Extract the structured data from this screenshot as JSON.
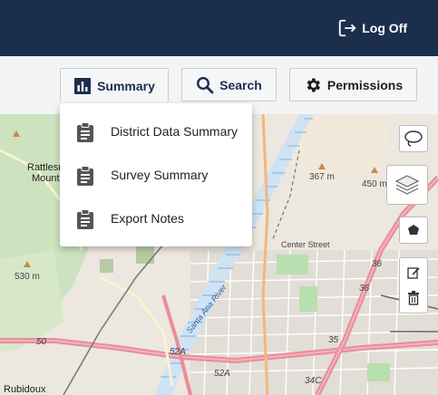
{
  "header": {
    "logoff_label": "Log Off",
    "background": "#1b2f4d"
  },
  "toolbar": {
    "summary_label": "Summary",
    "search_label": "Search",
    "permissions_label": "Permissions"
  },
  "summary_menu": {
    "items": [
      {
        "label": "District Data Summary",
        "icon": "clipboard-icon"
      },
      {
        "label": "Survey Summary",
        "icon": "clipboard-icon"
      },
      {
        "label": "Export Notes",
        "icon": "clipboard-icon"
      }
    ]
  },
  "map": {
    "labels": {
      "peak_367": "367 m",
      "peak_450": "450 m",
      "peak_530": "530 m",
      "rattlesnake": "Rattlesn",
      "mountain": "Mount",
      "center_street": "Center Street",
      "santa_ana_river": "Santa Ana River",
      "rubidoux": "Rubidoux",
      "route_50": "50",
      "route_52a_1": "52A",
      "route_52a_2": "52A",
      "route_35": "35",
      "route_36_1": "36",
      "route_36_2": "36",
      "route_34c": "34C"
    },
    "controls": [
      "lasso-icon",
      "layers-icon",
      "polygon-icon",
      "edit-icon",
      "trash-icon"
    ]
  }
}
